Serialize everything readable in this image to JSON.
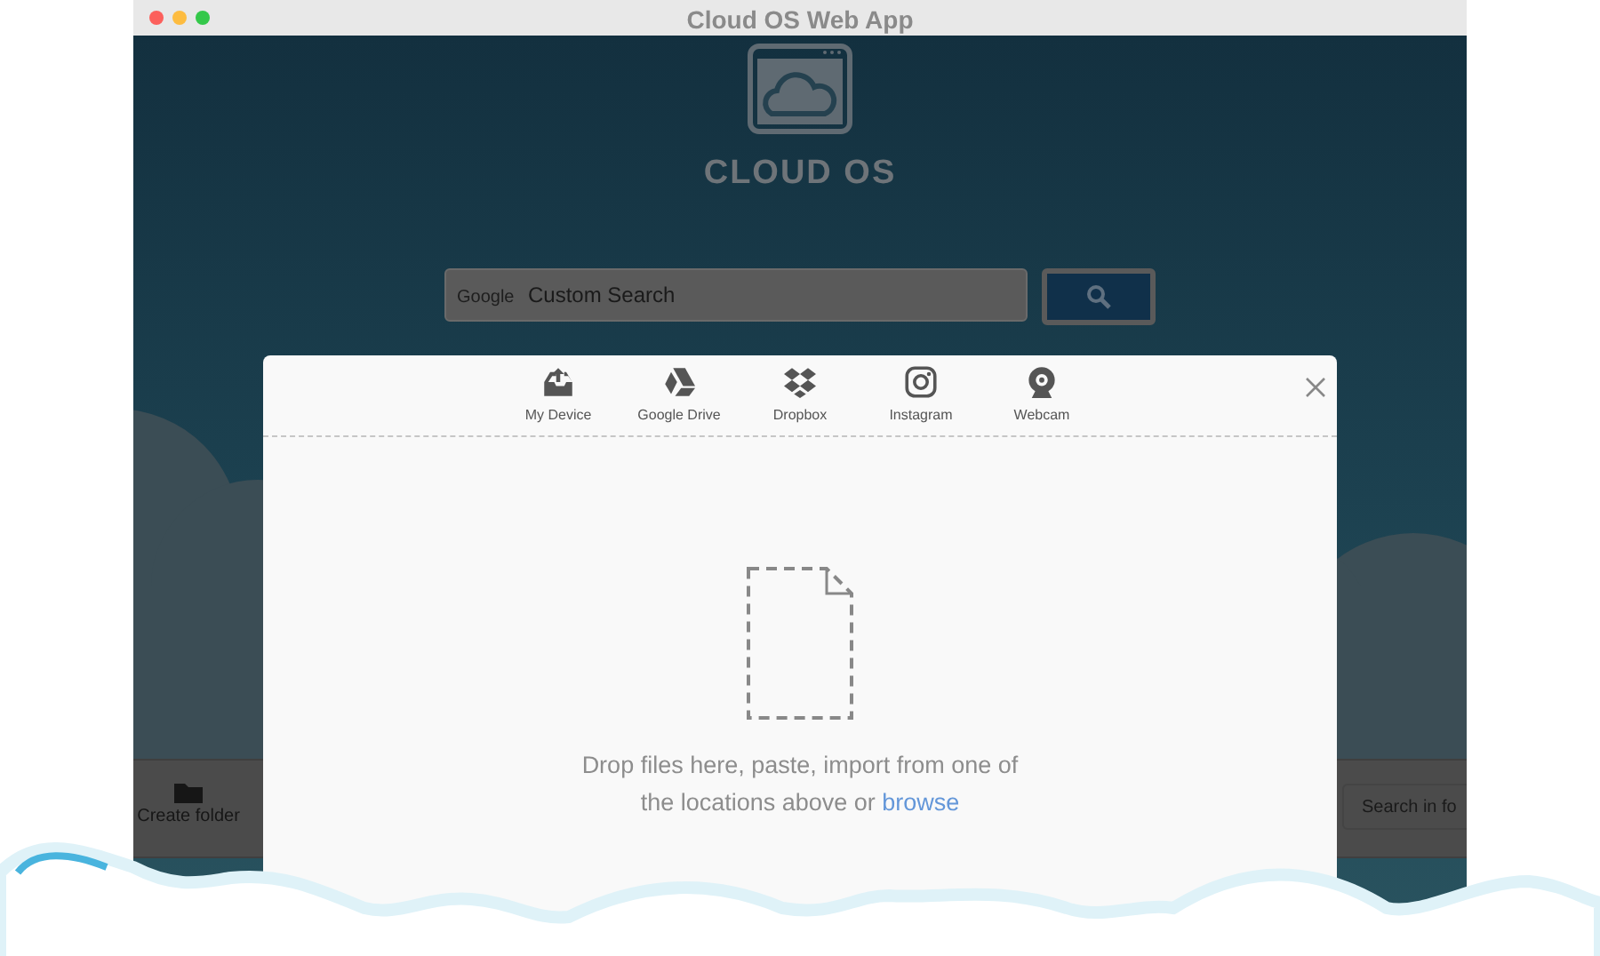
{
  "window": {
    "title": "Cloud OS Web App"
  },
  "header": {
    "logo_text": "CLOUD OS"
  },
  "search": {
    "engine_label": "Google",
    "placeholder": "Custom Search"
  },
  "toolbar": {
    "create_folder": "Create folder",
    "search_placeholder": "Search in fo"
  },
  "upload_dialog": {
    "sources": [
      {
        "kind": "device",
        "label": "My Device"
      },
      {
        "kind": "drive",
        "label": "Google Drive"
      },
      {
        "kind": "dropbox",
        "label": "Dropbox"
      },
      {
        "kind": "instagram",
        "label": "Instagram"
      },
      {
        "kind": "webcam",
        "label": "Webcam"
      }
    ],
    "message": "Drop files here, paste, import from one of the locations above or",
    "link": "browse"
  }
}
